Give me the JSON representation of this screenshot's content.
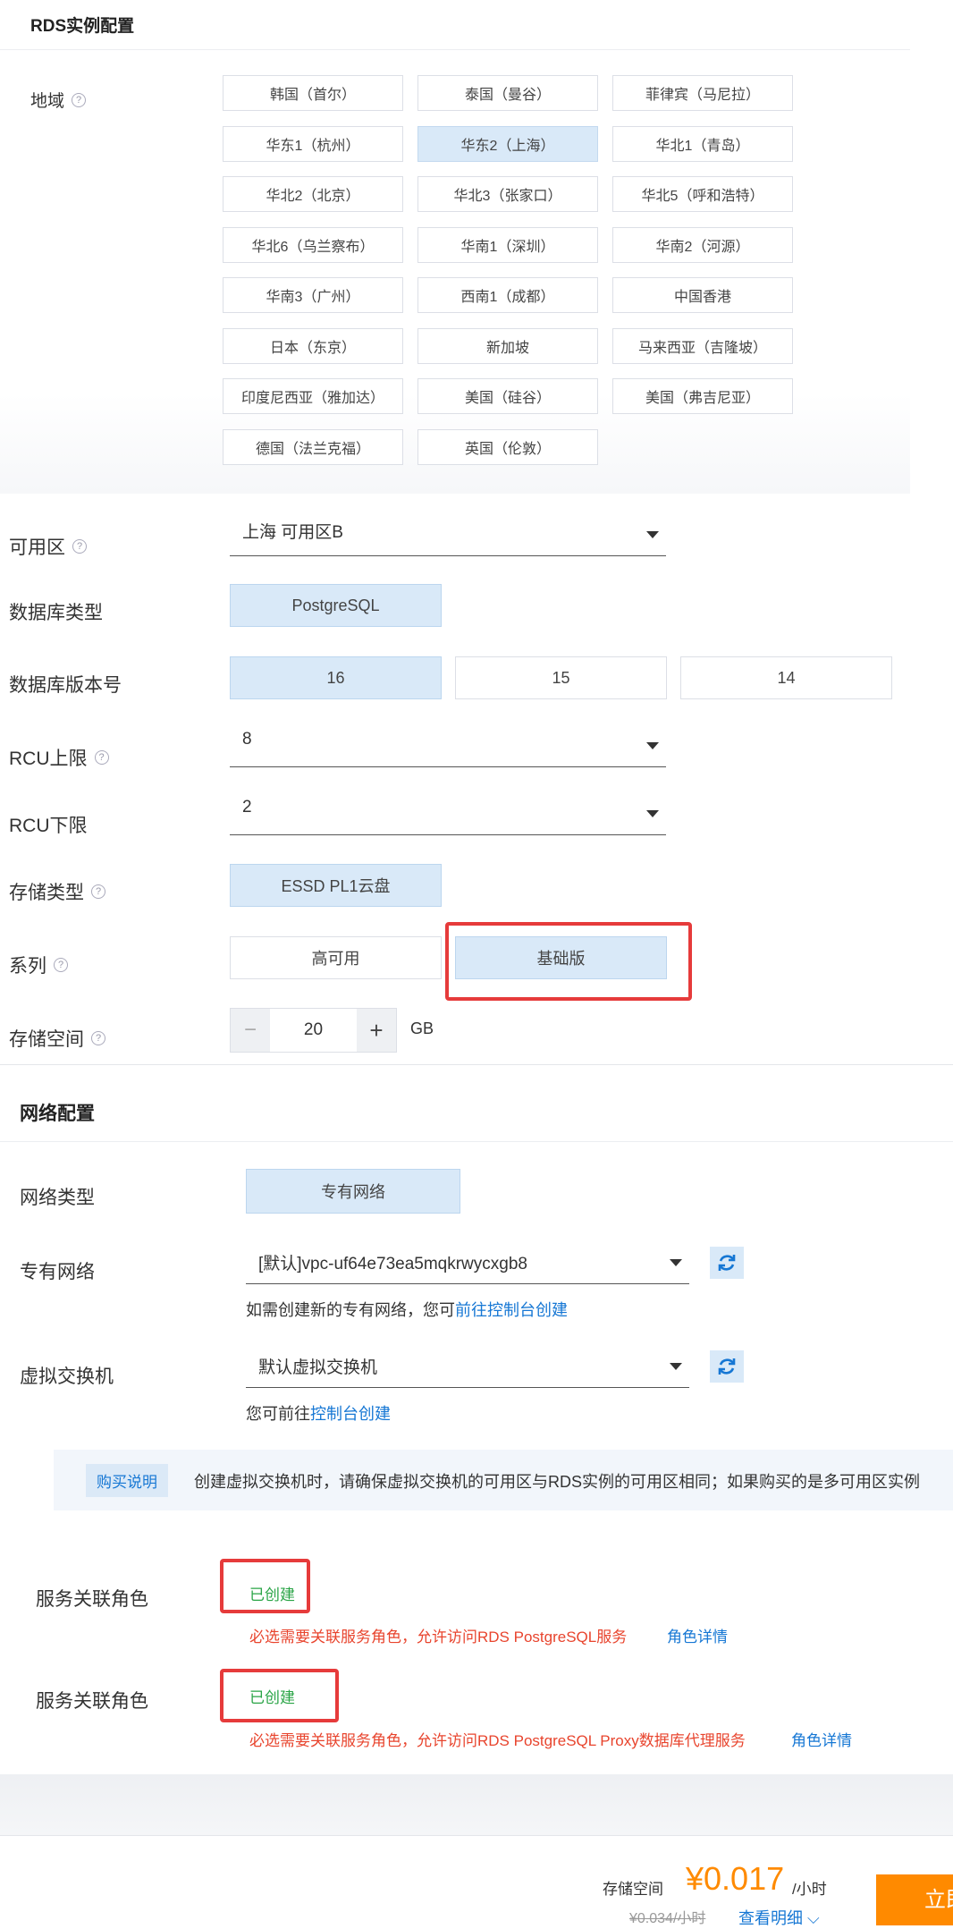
{
  "rds_section": {
    "title": "RDS实例配置"
  },
  "region": {
    "label": "地域",
    "options": [
      "韩国（首尔）",
      "泰国（曼谷）",
      "菲律宾（马尼拉）",
      "华东1（杭州）",
      "华东2（上海）",
      "华北1（青岛）",
      "华北2（北京）",
      "华北3（张家口）",
      "华北5（呼和浩特）",
      "华北6（乌兰察布）",
      "华南1（深圳）",
      "华南2（河源）",
      "华南3（广州）",
      "西南1（成都）",
      "中国香港",
      "日本（东京）",
      "新加坡",
      "马来西亚（吉隆坡）",
      "印度尼西亚（雅加达）",
      "美国（硅谷）",
      "美国（弗吉尼亚）",
      "德国（法兰克福）",
      "英国（伦敦）"
    ],
    "selected": "华东2（上海）"
  },
  "zone": {
    "label": "可用区",
    "value": "上海 可用区B"
  },
  "db_type": {
    "label": "数据库类型",
    "option": "PostgreSQL"
  },
  "db_version": {
    "label": "数据库版本号",
    "options": [
      "16",
      "15",
      "14"
    ],
    "selected": "16"
  },
  "rcu_max": {
    "label": "RCU上限",
    "value": "8"
  },
  "rcu_min": {
    "label": "RCU下限",
    "value": "2"
  },
  "storage_type": {
    "label": "存储类型",
    "option": "ESSD PL1云盘"
  },
  "series": {
    "label": "系列",
    "options": [
      "高可用",
      "基础版"
    ],
    "selected": "基础版"
  },
  "storage_space": {
    "label": "存储空间",
    "minus": "−",
    "value": "20",
    "plus": "+",
    "unit": "GB"
  },
  "network_section": {
    "title": "网络配置"
  },
  "network_type": {
    "label": "网络类型",
    "option": "专有网络"
  },
  "vpc": {
    "label": "专有网络",
    "value": "[默认]vpc-uf64e73ea5mqkrwycxgb8",
    "hint_prefix": "如需创建新的专有网络，您可",
    "hint_link": "前往控制台创建"
  },
  "vswitch": {
    "label": "虚拟交换机",
    "value": "默认虚拟交换机",
    "hint_prefix": "您可前往",
    "hint_link": "控制台创建"
  },
  "notice": {
    "tag": "购买说明",
    "text": "创建虚拟交换机时，请确保虚拟交换机的可用区与RDS实例的可用区相同；如果购买的是多可用区实例"
  },
  "service_role_1": {
    "label": "服务关联角色",
    "status": "已创建",
    "warning": "必选需要关联服务角色，允许访问RDS PostgreSQL服务",
    "link": "角色详情"
  },
  "service_role_2": {
    "label": "服务关联角色",
    "status": "已创建",
    "warning": "必选需要关联服务角色，允许访问RDS PostgreSQL Proxy数据库代理服务",
    "link": "角色详情"
  },
  "footer": {
    "price_label": "存储空间",
    "price": "¥0.017",
    "price_unit": "/小时",
    "original_price": "¥0.034/小时",
    "detail_link": "查看明细",
    "buy_button": "立即"
  },
  "colors": {
    "accent": "#1677d4",
    "selected_bg": "#d9e9f8",
    "highlight_red": "#e63b3b",
    "price_orange": "#ff8a00",
    "success_green": "#2aa446",
    "warning_red": "#e8442d"
  }
}
